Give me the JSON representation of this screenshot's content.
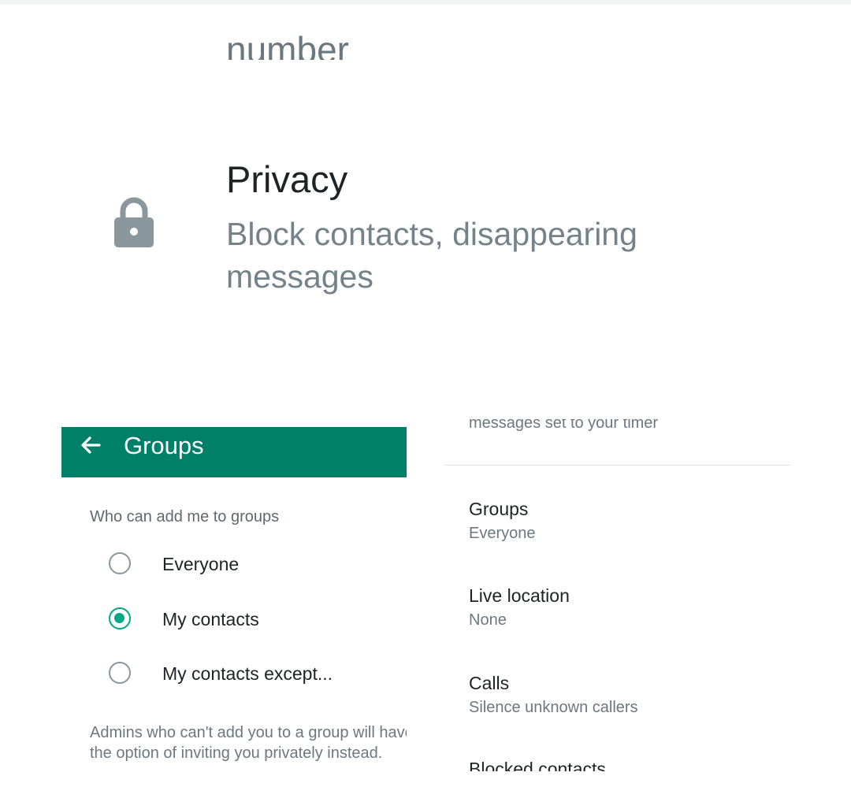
{
  "privacy_header": {
    "cut_text": "number",
    "title": "Privacy",
    "subtitle": "Block contacts, disappearing messages",
    "icon": "lock-icon"
  },
  "groups_screen": {
    "title": "Groups",
    "section_label": "Who can add me to groups",
    "options": [
      {
        "label": "Everyone",
        "selected": false
      },
      {
        "label": "My contacts",
        "selected": true
      },
      {
        "label": "My contacts except...",
        "selected": false
      }
    ],
    "footer": "Admins who can't add you to a group will have the option of inviting you privately instead.",
    "accent_color": "#008069",
    "radio_color": "#00a884"
  },
  "privacy_list": {
    "cut_text": "messages set to your timer",
    "items": [
      {
        "title": "Groups",
        "subtitle": "Everyone"
      },
      {
        "title": "Live location",
        "subtitle": "None"
      },
      {
        "title": "Calls",
        "subtitle": "Silence unknown callers"
      }
    ],
    "last_item_cut": "Blocked contacts"
  }
}
